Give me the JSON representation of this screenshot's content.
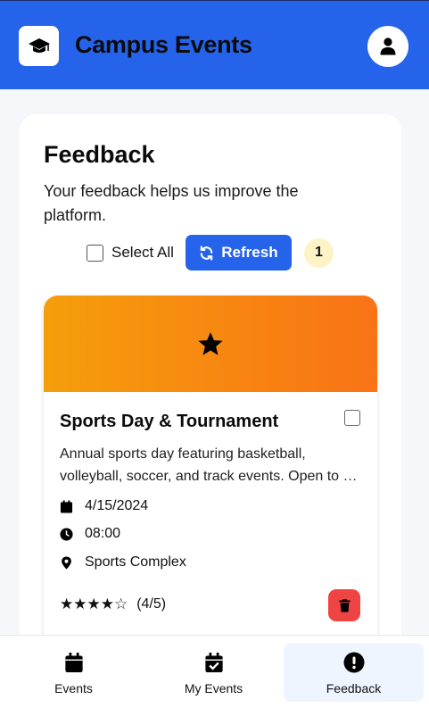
{
  "header": {
    "title": "Campus Events",
    "logo_icon": "graduation-cap-icon",
    "profile_icon": "user-icon"
  },
  "page": {
    "title": "Feedback",
    "description": "Your feedback helps us improve the platform."
  },
  "controls": {
    "select_all_label": "Select All",
    "refresh_label": "Refresh",
    "count": "1"
  },
  "event": {
    "title": "Sports Day & Tournament",
    "description_line1": "Annual sports day featuring basketball,",
    "description_line2": "volleyball, soccer, and track events. Open to all students.",
    "date": "4/15/2024",
    "time": "08:00",
    "location": "Sports Complex",
    "stars": "★★★★☆",
    "rating_text": "(4/5)",
    "rating_value": 4,
    "rating_max": 5,
    "banner_icon": "star-icon",
    "banner_gradient": [
      "#f59e0b",
      "#f97316"
    ]
  },
  "nav": {
    "items": [
      {
        "label": "Events",
        "icon": "calendar-icon"
      },
      {
        "label": "My Events",
        "icon": "calendar-check-icon"
      },
      {
        "label": "Feedback",
        "icon": "exclamation-circle-icon",
        "active": true
      }
    ]
  },
  "colors": {
    "primary": "#2563eb",
    "danger": "#ef4444",
    "badge": "#fef3c7",
    "nav_active": "#eff5fe"
  }
}
